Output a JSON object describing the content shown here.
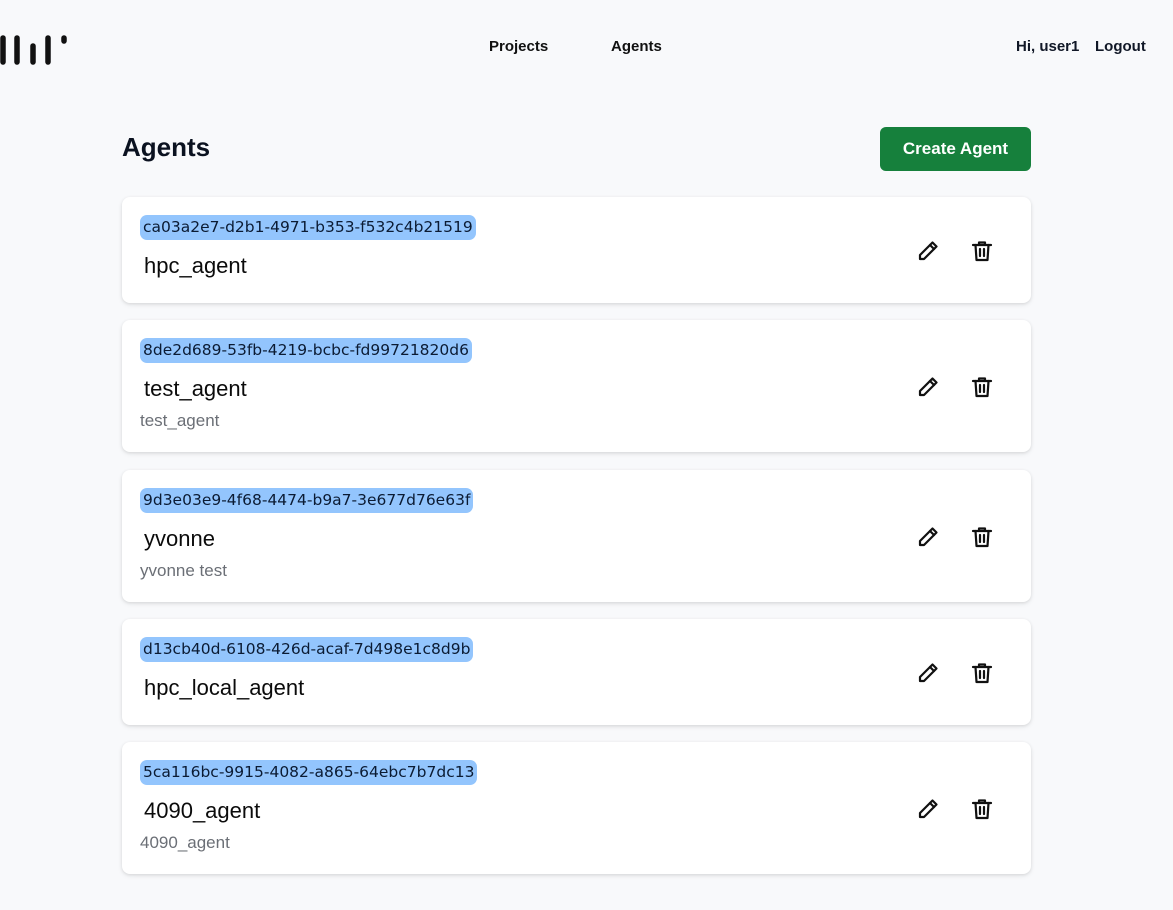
{
  "nav": {
    "logo_icon": "brand-logo-icon",
    "links": [
      "Projects",
      "Agents"
    ],
    "greeting": "Hi, user1",
    "logout": "Logout"
  },
  "page": {
    "title": "Agents",
    "create_button": "Create Agent"
  },
  "colors": {
    "accent_green": "#16803c",
    "id_highlight": "#93c5fd",
    "background": "#f8f9fb"
  },
  "agents": [
    {
      "id": "ca03a2e7-d2b1-4971-b353-f532c4b21519",
      "name": "hpc_agent",
      "description": ""
    },
    {
      "id": "8de2d689-53fb-4219-bcbc-fd99721820d6",
      "name": "test_agent",
      "description": "test_agent"
    },
    {
      "id": "9d3e03e9-4f68-4474-b9a7-3e677d76e63f",
      "name": "yvonne",
      "description": "yvonne test"
    },
    {
      "id": "d13cb40d-6108-426d-acaf-7d498e1c8d9b",
      "name": "hpc_local_agent",
      "description": ""
    },
    {
      "id": "5ca116bc-9915-4082-a865-64ebc7b7dc13",
      "name": "4090_agent",
      "description": "4090_agent"
    }
  ],
  "actions": {
    "edit_icon": "pencil-icon",
    "delete_icon": "trash-icon"
  }
}
